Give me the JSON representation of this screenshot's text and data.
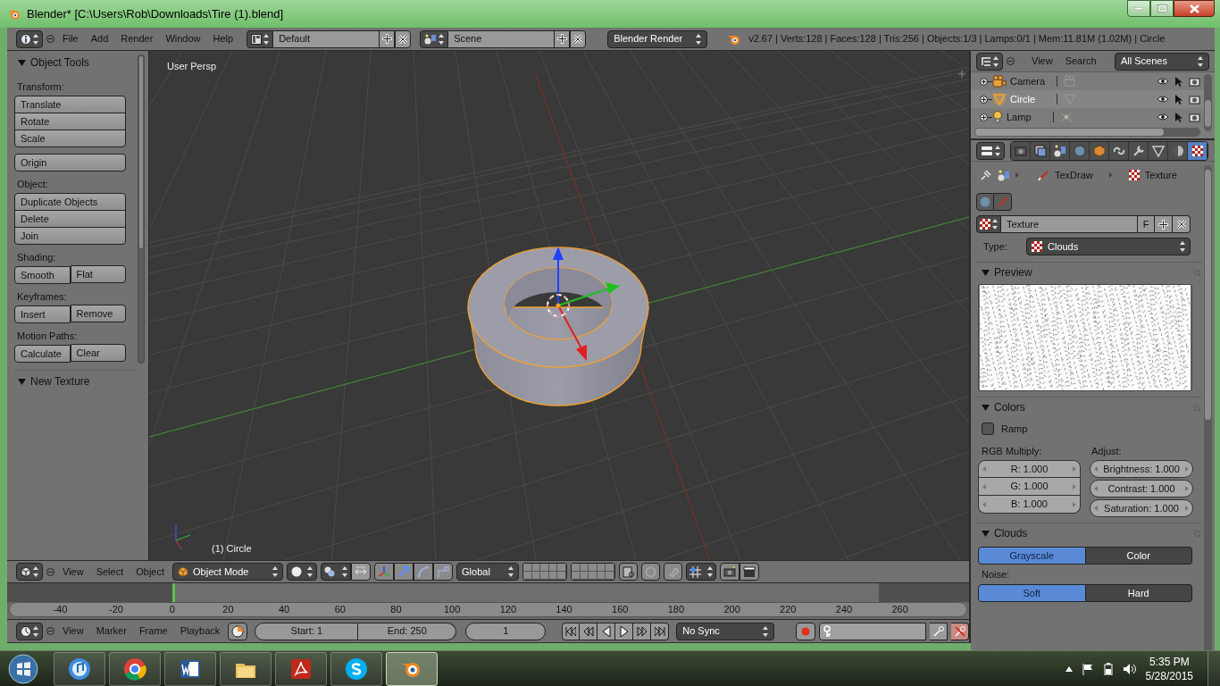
{
  "window": {
    "title": "Blender* [C:\\Users\\Rob\\Downloads\\Tire (1).blend]"
  },
  "info_header": {
    "menus": [
      "File",
      "Add",
      "Render",
      "Window",
      "Help"
    ],
    "layout": "Default",
    "scene": "Scene",
    "engine": "Blender Render",
    "stats": "v2.67 | Verts:128 | Faces:128 | Tris:256 | Objects:1/3 | Lamps:0/1 | Mem:11.81M (1.02M) | Circle"
  },
  "tool_shelf": {
    "panels": [
      {
        "title": "Object Tools",
        "expanded": true
      },
      {
        "title": "New Texture",
        "expanded": true
      }
    ],
    "sections": [
      {
        "label": "Transform:",
        "kind": "column",
        "buttons": [
          "Translate",
          "Rotate",
          "Scale"
        ]
      },
      {
        "kind": "column",
        "buttons": [
          "Origin"
        ]
      },
      {
        "label": "Object:",
        "kind": "column",
        "buttons": [
          "Duplicate Objects",
          "Delete",
          "Join"
        ]
      },
      {
        "label": "Shading:",
        "kind": "row",
        "buttons": [
          "Smooth",
          "Flat"
        ]
      },
      {
        "label": "Keyframes:",
        "kind": "row",
        "buttons": [
          "Insert",
          "Remove"
        ]
      },
      {
        "label": "Motion Paths:",
        "kind": "row",
        "buttons": [
          "Calculate",
          "Clear"
        ]
      }
    ]
  },
  "viewport": {
    "view_label": "User Persp",
    "object_label": "(1) Circle"
  },
  "viewport_header": {
    "menus": [
      "View",
      "Select",
      "Object"
    ],
    "mode": "Object Mode",
    "orientation": "Global"
  },
  "timeline": {
    "ticks": [
      "-40",
      "-20",
      "0",
      "20",
      "40",
      "60",
      "80",
      "100",
      "120",
      "140",
      "160",
      "180",
      "200",
      "220",
      "240",
      "260"
    ],
    "playhead": {
      "level": 0.172
    }
  },
  "timeline_header": {
    "menus": [
      "View",
      "Marker",
      "Frame",
      "Playback"
    ],
    "start": "Start: 1",
    "end": "End: 250",
    "current_frame": "1",
    "sync": "No Sync"
  },
  "outliner": {
    "menus": [
      "View",
      "Search"
    ],
    "filter": "All Scenes",
    "items": [
      {
        "name": "Camera",
        "kind": "camera",
        "selected": false
      },
      {
        "name": "Circle",
        "kind": "mesh",
        "selected": true
      },
      {
        "name": "Lamp",
        "kind": "lamp",
        "selected": false
      }
    ]
  },
  "properties": {
    "tabs": [
      {
        "kind": "render",
        "selected": false
      },
      {
        "kind": "render_layers",
        "selected": false
      },
      {
        "kind": "scene",
        "selected": false
      },
      {
        "kind": "world",
        "selected": false
      },
      {
        "kind": "object",
        "selected": false
      },
      {
        "kind": "constraints",
        "selected": false
      },
      {
        "kind": "modifiers",
        "selected": false
      },
      {
        "kind": "data",
        "selected": false
      },
      {
        "kind": "material",
        "selected": false
      },
      {
        "kind": "texture",
        "selected": true
      }
    ],
    "breadcrumb": [
      "TexDraw",
      "Texture"
    ],
    "texture": {
      "name": "Texture",
      "fake_user": "F"
    },
    "type_label": "Type:",
    "type": "Clouds",
    "panels": [
      {
        "title": "Preview",
        "expanded": true
      },
      {
        "title": "Colors",
        "expanded": true
      },
      {
        "title": "Clouds",
        "expanded": true
      }
    ],
    "ramp": {
      "label": "Ramp",
      "checked": false
    },
    "rgb_label": "RGB Multiply:",
    "rgb": [
      "R: 1.000",
      "G: 1.000",
      "B: 1.000"
    ],
    "adjust_label": "Adjust:",
    "adjust": [
      "Brightness: 1.000",
      "Contrast: 1.000",
      "Saturation: 1.000"
    ],
    "color_mode": [
      {
        "label": "Grayscale",
        "selected": true
      },
      {
        "label": "Color",
        "selected": false
      }
    ],
    "noise_label": "Noise:",
    "noise": [
      {
        "label": "Soft",
        "selected": true
      },
      {
        "label": "Hard",
        "selected": false
      }
    ]
  },
  "taskbar": {
    "apps": [
      {
        "kind": "itunes",
        "selected": false
      },
      {
        "kind": "chrome",
        "selected": false
      },
      {
        "kind": "word",
        "selected": false
      },
      {
        "kind": "explorer",
        "selected": false
      },
      {
        "kind": "acrobat",
        "selected": false
      },
      {
        "kind": "skype",
        "selected": false
      },
      {
        "kind": "blender",
        "selected": true
      }
    ],
    "time": "5:35 PM",
    "date": "5/28/2015"
  }
}
